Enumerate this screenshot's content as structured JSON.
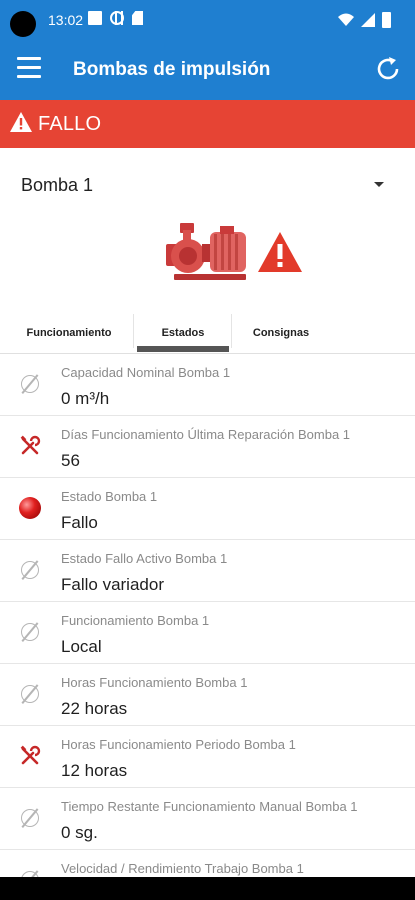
{
  "status_bar": {
    "time": "13:02"
  },
  "app_bar": {
    "title": "Bombas de impulsión"
  },
  "alarm": {
    "text": "FALLO",
    "color": "#e64434"
  },
  "selector": {
    "value": "Bomba 1"
  },
  "tabs": [
    {
      "label": "Funcionamiento"
    },
    {
      "label": "Estados",
      "active": true
    },
    {
      "label": "Consignas"
    }
  ],
  "list": [
    {
      "icon": "null-icon",
      "label": "Capacidad Nominal Bomba 1",
      "value": "0 m³/h"
    },
    {
      "icon": "wrench-screwdriver-icon",
      "label": "Días Funcionamiento Última Reparación Bomba 1",
      "value": "56"
    },
    {
      "icon": "red-status-ball-icon",
      "label": "Estado Bomba 1",
      "value": "Fallo"
    },
    {
      "icon": "null-icon",
      "label": "Estado Fallo Activo Bomba 1",
      "value": "Fallo variador"
    },
    {
      "icon": "null-icon",
      "label": "Funcionamiento Bomba 1",
      "value": "Local"
    },
    {
      "icon": "null-icon",
      "label": "Horas Funcionamiento Bomba 1",
      "value": "22 horas"
    },
    {
      "icon": "wrench-screwdriver-icon",
      "label": "Horas Funcionamiento Periodo Bomba 1",
      "value": "12 horas"
    },
    {
      "icon": "null-icon",
      "label": "Tiempo Restante Funcionamiento Manual Bomba 1",
      "value": "0 sg."
    },
    {
      "icon": "null-icon",
      "label": "Velocidad / Rendimiento Trabajo Bomba 1",
      "value": ""
    }
  ],
  "colors": {
    "primary": "#1f7fd0",
    "alarm": "#e64434",
    "tool_icon": "#c62828"
  }
}
